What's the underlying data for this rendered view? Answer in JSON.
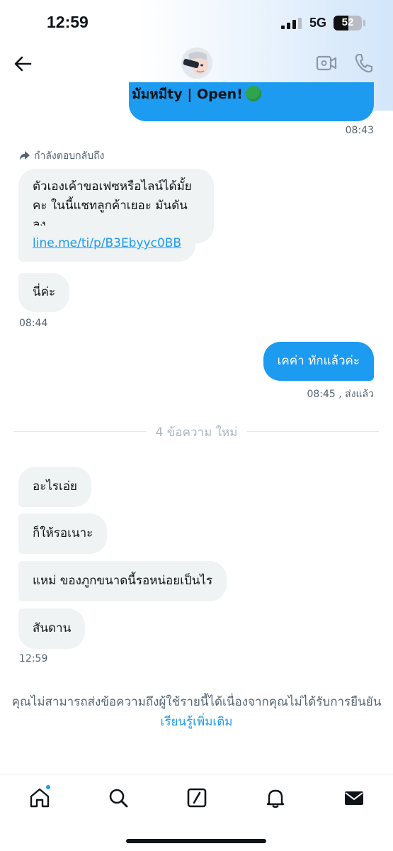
{
  "status_bar": {
    "time": "12:59",
    "network": "5G",
    "battery": "52",
    "battery_level": 0.52
  },
  "header": {
    "display_name": "มัมหมีty | Open!",
    "online_indicator": "green-circle-emoji"
  },
  "messages": {
    "prev_out_time": "08:43",
    "reply_label": "กำลังตอบกลับถึง",
    "in1_text": "ตัวเองเค้าขอเฟซหรือไลน์ได้มั้ยคะ ในนี้แชทลูกค้าเยอะ มันดันลง",
    "in1_link": "line.me/ti/p/B3Ebyyc0BB",
    "in2_text": "นี่ค่ะ",
    "in_time1": "08:44",
    "out1_text": "เคค่า ทักแล้วค่ะ",
    "out1_status": "08:45 , ส่งแล้ว",
    "new_divider": "4 ข้อความ ใหม่",
    "new1": "อะไรเอ่ย",
    "new2": "ก็ให้รอเนาะ",
    "new3": "แหม่ ของภูกขนาดนี้รอหน่อยเป็นไร",
    "new4": "สันดาน",
    "in_time2": "12:59"
  },
  "notice": {
    "text": "คุณไม่สามารถส่งข้อความถึงผู้ใช้รายนี้ได้เนื่องจากคุณไม่ได้รับการยืนยัน",
    "link": "เรียนรู้เพิ่มเติม"
  },
  "tabbar": {
    "icons": [
      "home-icon",
      "search-icon",
      "grok-icon",
      "bell-icon",
      "mail-icon"
    ],
    "accent": "#1d9bf0"
  }
}
